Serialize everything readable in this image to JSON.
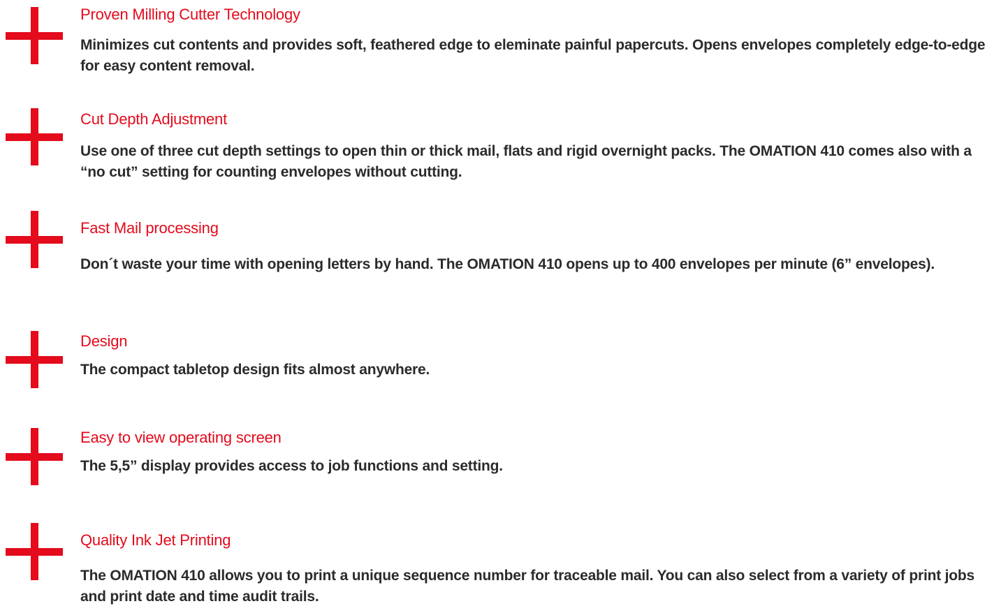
{
  "colors": {
    "accent": "#e30b1c",
    "text": "#2b2b2b"
  },
  "icons": {
    "feature_marker": "plus-cross-icon"
  },
  "features": [
    {
      "title": "Proven Milling Cutter Technology",
      "description": "Minimizes cut contents and provides soft, feathered edge to eleminate painful papercuts. Opens envelopes completely edge-to-edge for easy content removal."
    },
    {
      "title": "Cut Depth Adjustment",
      "description": "Use one of three cut depth settings to open thin or thick mail, flats and rigid overnight packs. The OMATION 410 comes also with a “no cut” setting for counting envelopes without cutting."
    },
    {
      "title": "Fast Mail processing",
      "description": "Don´t waste your time with opening letters by hand. The OMATION 410 opens up to 400 envelopes per minute (6” envelopes)."
    },
    {
      "title": "Design",
      "description": "The compact tabletop design fits almost anywhere."
    },
    {
      "title": "Easy to view operating screen",
      "description": "The 5,5” display provides access to job functions and setting."
    },
    {
      "title": "Quality Ink Jet Printing",
      "description": "The OMATION 410 allows you to print a unique sequence number for traceable mail. You can also select from a variety of print jobs and print date and time audit trails."
    }
  ]
}
